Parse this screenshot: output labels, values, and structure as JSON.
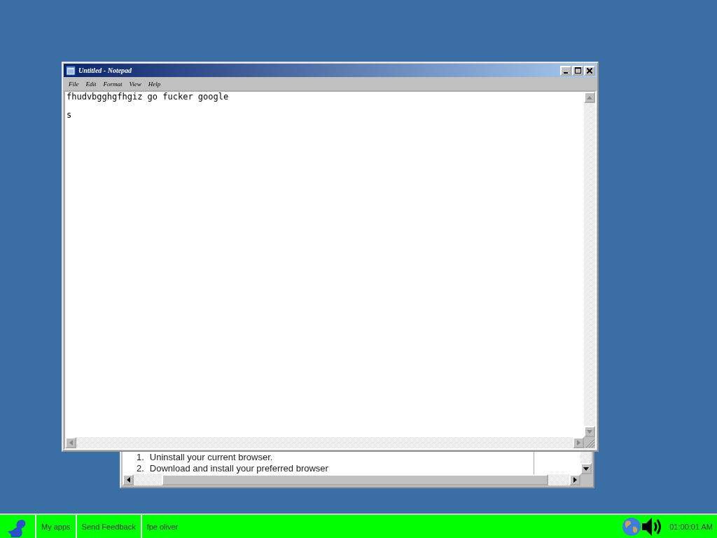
{
  "background_window": {
    "list_items": [
      {
        "number": "1.",
        "text": "Uninstall your current browser."
      },
      {
        "number": "2.",
        "text": "Download and install your preferred browser"
      }
    ]
  },
  "notepad": {
    "title": "Untitled - Notepad",
    "menu": [
      "File",
      "Edit",
      "Format",
      "View",
      "Help"
    ],
    "content": "fhudvbgghgfhgiz go fucker google\n\ns"
  },
  "taskbar": {
    "items": [
      "My apps",
      "Send Feedback",
      "fpe oliver"
    ],
    "clock": "01:00:01 AM"
  }
}
